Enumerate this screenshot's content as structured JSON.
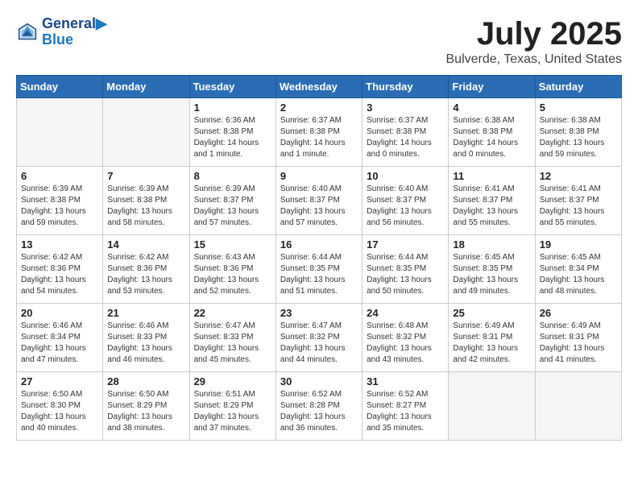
{
  "header": {
    "logo": {
      "line1": "General",
      "line2": "Blue"
    },
    "title": "July 2025",
    "location": "Bulverde, Texas, United States"
  },
  "weekdays": [
    "Sunday",
    "Monday",
    "Tuesday",
    "Wednesday",
    "Thursday",
    "Friday",
    "Saturday"
  ],
  "weeks": [
    [
      {
        "day": "",
        "info": ""
      },
      {
        "day": "",
        "info": ""
      },
      {
        "day": "1",
        "info": "Sunrise: 6:36 AM\nSunset: 8:38 PM\nDaylight: 14 hours\nand 1 minute."
      },
      {
        "day": "2",
        "info": "Sunrise: 6:37 AM\nSunset: 8:38 PM\nDaylight: 14 hours\nand 1 minute."
      },
      {
        "day": "3",
        "info": "Sunrise: 6:37 AM\nSunset: 8:38 PM\nDaylight: 14 hours\nand 0 minutes."
      },
      {
        "day": "4",
        "info": "Sunrise: 6:38 AM\nSunset: 8:38 PM\nDaylight: 14 hours\nand 0 minutes."
      },
      {
        "day": "5",
        "info": "Sunrise: 6:38 AM\nSunset: 8:38 PM\nDaylight: 13 hours\nand 59 minutes."
      }
    ],
    [
      {
        "day": "6",
        "info": "Sunrise: 6:39 AM\nSunset: 8:38 PM\nDaylight: 13 hours\nand 59 minutes."
      },
      {
        "day": "7",
        "info": "Sunrise: 6:39 AM\nSunset: 8:38 PM\nDaylight: 13 hours\nand 58 minutes."
      },
      {
        "day": "8",
        "info": "Sunrise: 6:39 AM\nSunset: 8:37 PM\nDaylight: 13 hours\nand 57 minutes."
      },
      {
        "day": "9",
        "info": "Sunrise: 6:40 AM\nSunset: 8:37 PM\nDaylight: 13 hours\nand 57 minutes."
      },
      {
        "day": "10",
        "info": "Sunrise: 6:40 AM\nSunset: 8:37 PM\nDaylight: 13 hours\nand 56 minutes."
      },
      {
        "day": "11",
        "info": "Sunrise: 6:41 AM\nSunset: 8:37 PM\nDaylight: 13 hours\nand 55 minutes."
      },
      {
        "day": "12",
        "info": "Sunrise: 6:41 AM\nSunset: 8:37 PM\nDaylight: 13 hours\nand 55 minutes."
      }
    ],
    [
      {
        "day": "13",
        "info": "Sunrise: 6:42 AM\nSunset: 8:36 PM\nDaylight: 13 hours\nand 54 minutes."
      },
      {
        "day": "14",
        "info": "Sunrise: 6:42 AM\nSunset: 8:36 PM\nDaylight: 13 hours\nand 53 minutes."
      },
      {
        "day": "15",
        "info": "Sunrise: 6:43 AM\nSunset: 8:36 PM\nDaylight: 13 hours\nand 52 minutes."
      },
      {
        "day": "16",
        "info": "Sunrise: 6:44 AM\nSunset: 8:35 PM\nDaylight: 13 hours\nand 51 minutes."
      },
      {
        "day": "17",
        "info": "Sunrise: 6:44 AM\nSunset: 8:35 PM\nDaylight: 13 hours\nand 50 minutes."
      },
      {
        "day": "18",
        "info": "Sunrise: 6:45 AM\nSunset: 8:35 PM\nDaylight: 13 hours\nand 49 minutes."
      },
      {
        "day": "19",
        "info": "Sunrise: 6:45 AM\nSunset: 8:34 PM\nDaylight: 13 hours\nand 48 minutes."
      }
    ],
    [
      {
        "day": "20",
        "info": "Sunrise: 6:46 AM\nSunset: 8:34 PM\nDaylight: 13 hours\nand 47 minutes."
      },
      {
        "day": "21",
        "info": "Sunrise: 6:46 AM\nSunset: 8:33 PM\nDaylight: 13 hours\nand 46 minutes."
      },
      {
        "day": "22",
        "info": "Sunrise: 6:47 AM\nSunset: 8:33 PM\nDaylight: 13 hours\nand 45 minutes."
      },
      {
        "day": "23",
        "info": "Sunrise: 6:47 AM\nSunset: 8:32 PM\nDaylight: 13 hours\nand 44 minutes."
      },
      {
        "day": "24",
        "info": "Sunrise: 6:48 AM\nSunset: 8:32 PM\nDaylight: 13 hours\nand 43 minutes."
      },
      {
        "day": "25",
        "info": "Sunrise: 6:49 AM\nSunset: 8:31 PM\nDaylight: 13 hours\nand 42 minutes."
      },
      {
        "day": "26",
        "info": "Sunrise: 6:49 AM\nSunset: 8:31 PM\nDaylight: 13 hours\nand 41 minutes."
      }
    ],
    [
      {
        "day": "27",
        "info": "Sunrise: 6:50 AM\nSunset: 8:30 PM\nDaylight: 13 hours\nand 40 minutes."
      },
      {
        "day": "28",
        "info": "Sunrise: 6:50 AM\nSunset: 8:29 PM\nDaylight: 13 hours\nand 38 minutes."
      },
      {
        "day": "29",
        "info": "Sunrise: 6:51 AM\nSunset: 8:29 PM\nDaylight: 13 hours\nand 37 minutes."
      },
      {
        "day": "30",
        "info": "Sunrise: 6:52 AM\nSunset: 8:28 PM\nDaylight: 13 hours\nand 36 minutes."
      },
      {
        "day": "31",
        "info": "Sunrise: 6:52 AM\nSunset: 8:27 PM\nDaylight: 13 hours\nand 35 minutes."
      },
      {
        "day": "",
        "info": ""
      },
      {
        "day": "",
        "info": ""
      }
    ]
  ]
}
